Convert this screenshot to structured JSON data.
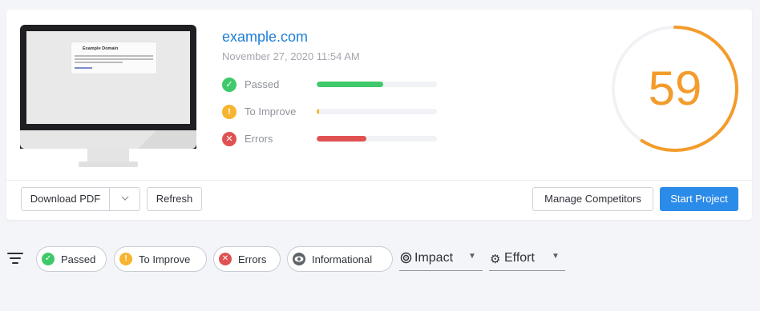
{
  "report": {
    "domain": "example.com",
    "timestamp": "November 27, 2020 11:54 AM",
    "score": "59",
    "score_fraction": 0.59,
    "score_color": "#f39c2c",
    "preview": {
      "title": "Example Domain"
    },
    "metrics": [
      {
        "label": "Passed",
        "icon": "check-icon",
        "glyph": "✓",
        "color": "#3fc96a",
        "fraction": 0.55
      },
      {
        "label": "To Improve",
        "icon": "exclamation-icon",
        "glyph": "!",
        "color": "#f6b430",
        "fraction": 0.02
      },
      {
        "label": "Errors",
        "icon": "cross-icon",
        "glyph": "✕",
        "color": "#e05252",
        "fraction": 0.41
      }
    ]
  },
  "actions": {
    "download_pdf": "Download PDF",
    "refresh": "Refresh",
    "manage_competitors": "Manage Competitors",
    "start_project": "Start Project"
  },
  "filters": {
    "chips": [
      {
        "label": "Passed",
        "icon": "check-icon",
        "glyph": "✓",
        "color": "#3fc96a"
      },
      {
        "label": "To Improve",
        "icon": "exclamation-icon",
        "glyph": "!",
        "color": "#f6b430"
      },
      {
        "label": "Errors",
        "icon": "cross-icon",
        "glyph": "✕",
        "color": "#e05252"
      },
      {
        "label": "Informational",
        "icon": "eye-icon",
        "glyph": "●",
        "color": "#5f6469"
      }
    ],
    "impact_label": "Impact",
    "effort_label": "Effort"
  }
}
